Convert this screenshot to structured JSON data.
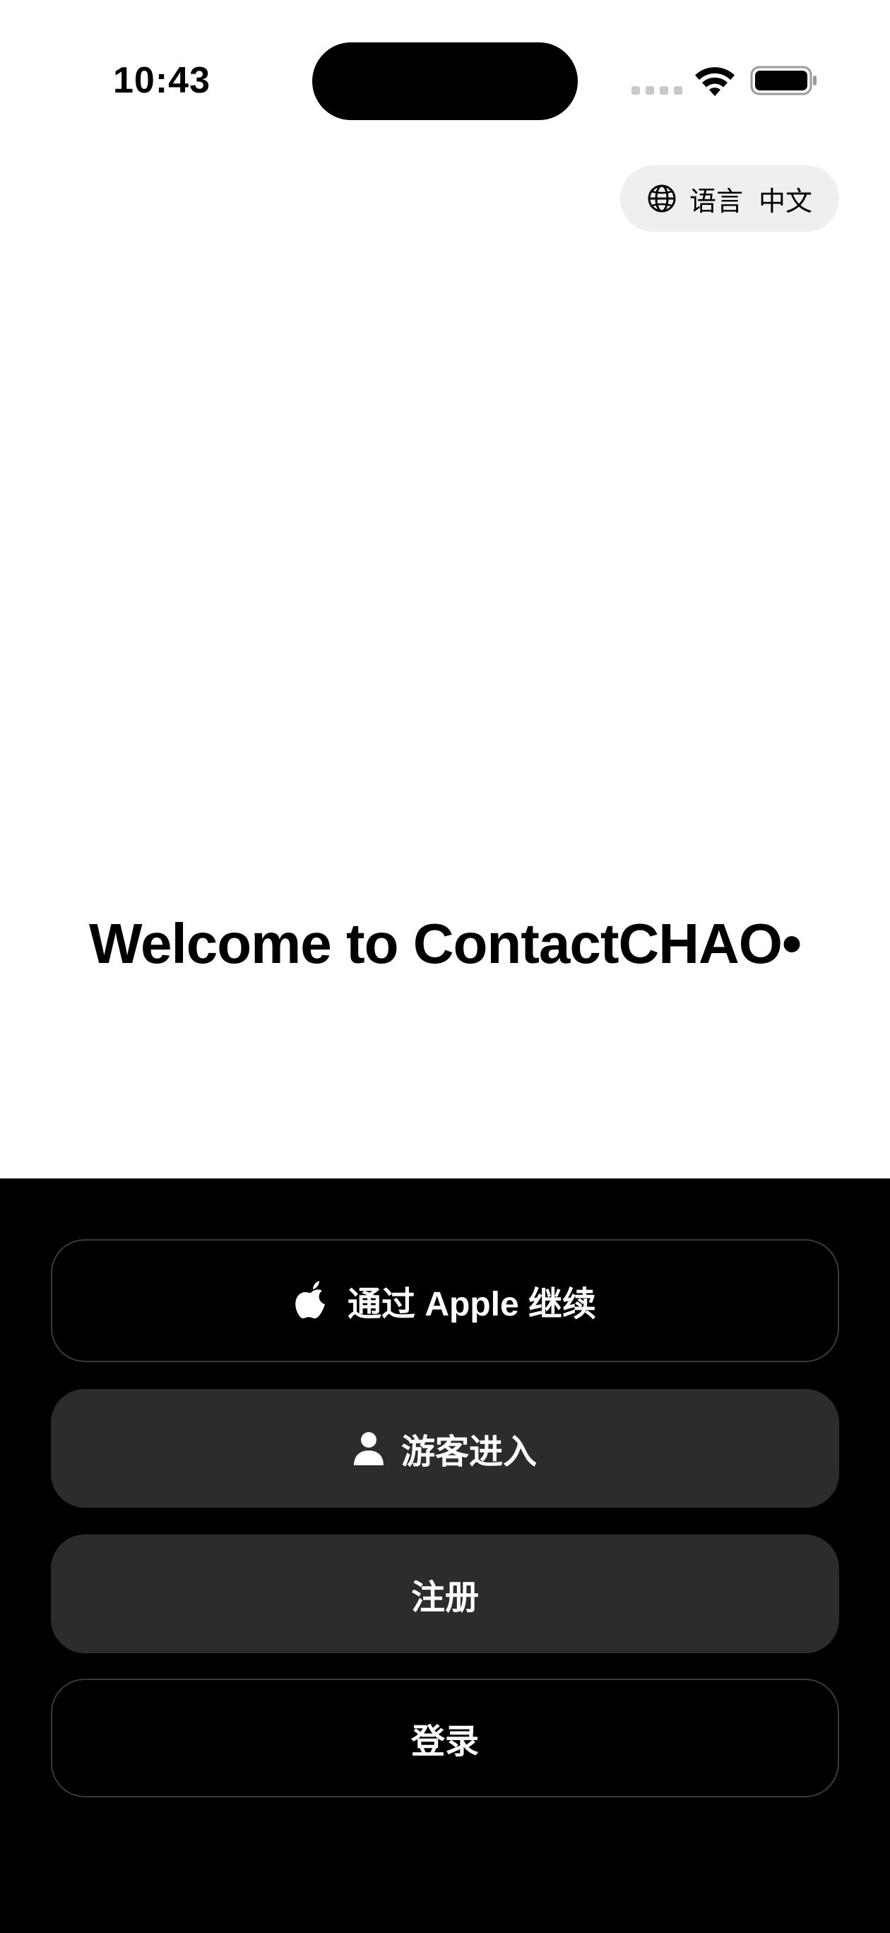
{
  "status_bar": {
    "time": "10:43"
  },
  "language": {
    "icon": "globe-icon",
    "label": "语言",
    "value": "中文"
  },
  "welcome": {
    "title": "Welcome to ContactCHAO•"
  },
  "actions": {
    "apple": {
      "icon": "apple-icon",
      "label": "通过 Apple 继续"
    },
    "guest": {
      "icon": "person-icon",
      "label": "游客进入"
    },
    "register": {
      "label": "注册"
    },
    "login": {
      "label": "登录"
    }
  },
  "colors": {
    "background": "#ffffff",
    "sheet": "#000000",
    "filled_button": "#2c2c2c",
    "pill": "#efefef"
  }
}
